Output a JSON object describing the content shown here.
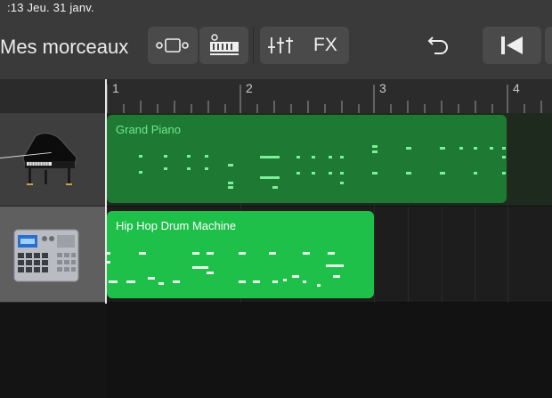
{
  "status_bar": {
    "time_date": ":13   Jeu. 31 janv."
  },
  "toolbar": {
    "title": "Mes morceaux",
    "fx_label": "FX",
    "icons": [
      "view-toggle-icon",
      "track-view-icon",
      "mixer-icon",
      "undo-icon",
      "go-to-start-icon"
    ]
  },
  "ruler": {
    "bars": [
      "1",
      "2",
      "3",
      "4"
    ]
  },
  "tracks": [
    {
      "instrument_icon": "grand-piano-icon",
      "region": {
        "name": "Grand Piano",
        "color": "#1e7a32"
      }
    },
    {
      "instrument_icon": "drum-machine-icon",
      "region": {
        "name": "Hip Hop Drum Machine",
        "color": "#1ec04a"
      }
    }
  ],
  "colors": {
    "toolbar": "#3a3a3a",
    "selected_header": "#5f5f5f",
    "playhead": "#e8e8e8"
  }
}
